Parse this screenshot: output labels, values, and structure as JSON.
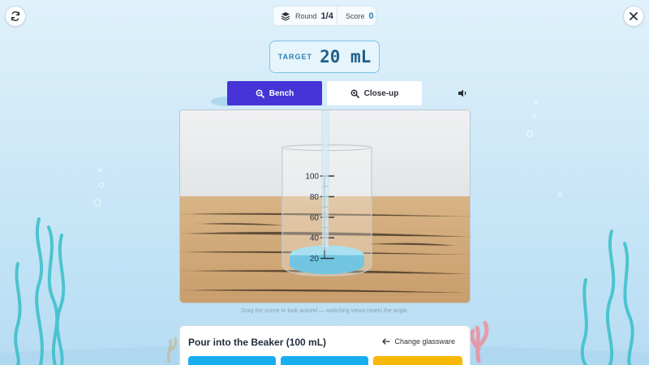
{
  "hud": {
    "round_label": "Round",
    "round_value": "1/4",
    "score_label": "Score",
    "score_value": "0"
  },
  "target": {
    "label": "TARGET",
    "amount": "20 mL"
  },
  "views": {
    "bench": "Bench",
    "closeup": "Close-up",
    "active": "bench"
  },
  "beaker": {
    "scale_labels": [
      "100",
      "80",
      "60",
      "40",
      "20"
    ],
    "fill_ml": 20,
    "capacity_ml": 100
  },
  "hint": "Drag the scene to look around — switching views resets the angle.",
  "panel": {
    "title": "Pour into the Beaker (100 mL)",
    "change_label": "Change glassware"
  },
  "colors": {
    "accent": "#4634d6",
    "option_blue": "#19aef0",
    "option_yellow": "#f7b707",
    "liquid": "#7fd0ea"
  },
  "icons": [
    "refresh-icon",
    "close-icon",
    "layers-icon",
    "search-icon",
    "zoom-in-icon",
    "speaker-icon",
    "arrow-left-icon"
  ]
}
